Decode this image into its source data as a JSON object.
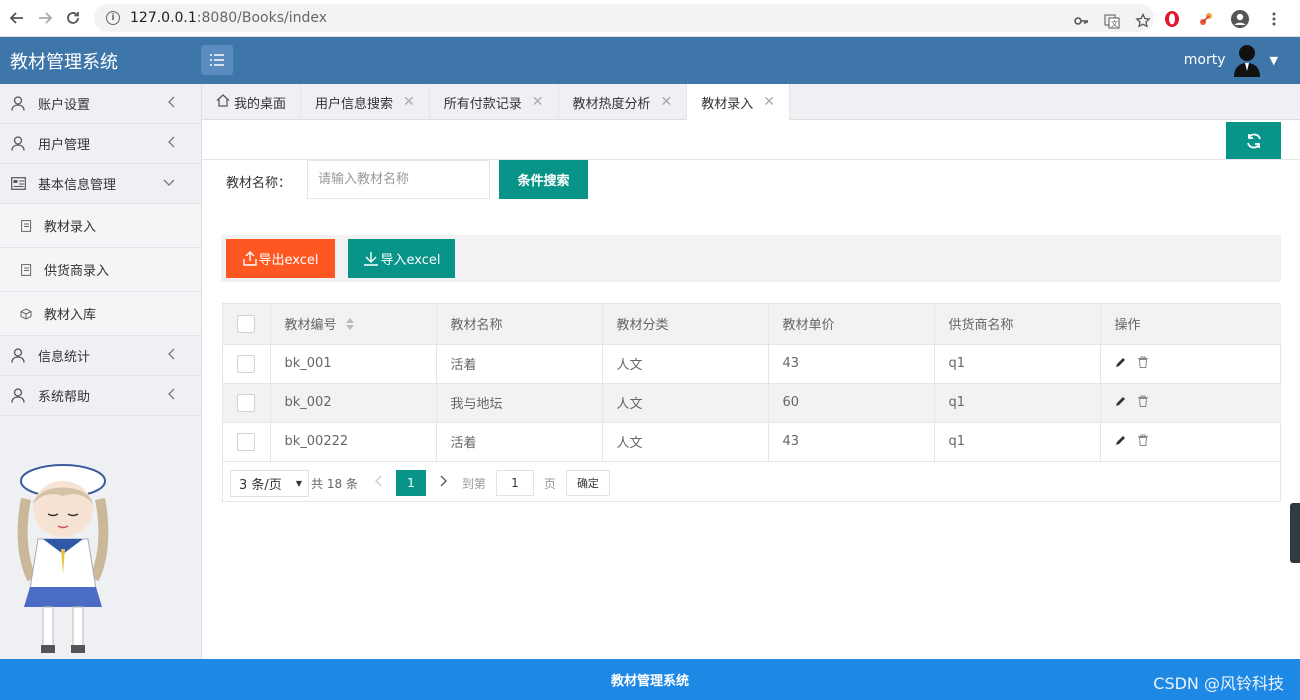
{
  "browser": {
    "url_host": "127.0.0.1",
    "url_rest": ":8080/Books/index"
  },
  "app": {
    "brand": "教材管理系统",
    "username": "morty"
  },
  "sidebar": {
    "items": [
      {
        "label": "账户设置",
        "icon": "user-icon"
      },
      {
        "label": "用户管理",
        "icon": "user-icon"
      },
      {
        "label": "基本信息管理",
        "icon": "card-icon"
      },
      {
        "label": "信息统计",
        "icon": "user-icon"
      },
      {
        "label": "系统帮助",
        "icon": "user-icon"
      }
    ],
    "sub_items": [
      {
        "label": "教材录入"
      },
      {
        "label": "供货商录入"
      },
      {
        "label": "教材入库"
      }
    ]
  },
  "tabs": [
    {
      "label": "我的桌面"
    },
    {
      "label": "用户信息搜索"
    },
    {
      "label": "所有付款记录"
    },
    {
      "label": "教材热度分析"
    },
    {
      "label": "教材录入"
    }
  ],
  "search": {
    "label": "教材名称：",
    "placeholder": "请输入教材名称",
    "button": "条件搜索"
  },
  "toolbar": {
    "export_label": "导出excel",
    "import_label": "导入excel"
  },
  "table": {
    "headers": [
      "教材编号",
      "教材名称",
      "教材分类",
      "教材单价",
      "供货商名称",
      "操作"
    ],
    "rows": [
      [
        "bk_001",
        "活着",
        "人文",
        "43",
        "q1"
      ],
      [
        "bk_002",
        "我与地坛",
        "人文",
        "60",
        "q1"
      ],
      [
        "bk_00222",
        "活着",
        "人文",
        "43",
        "q1"
      ]
    ]
  },
  "pager": {
    "limit": "3 条/页",
    "total": "共 18 条",
    "current": "1",
    "goto_label": "到第",
    "goto_value": "1",
    "page_unit": "页",
    "confirm": "确定"
  },
  "footer": {
    "text": "教材管理系统",
    "watermark": "CSDN @风铃科技"
  },
  "colors": {
    "header": "#3f76aa",
    "primary": "#089488",
    "danger": "#ff5722",
    "footer": "#1e88e5"
  }
}
